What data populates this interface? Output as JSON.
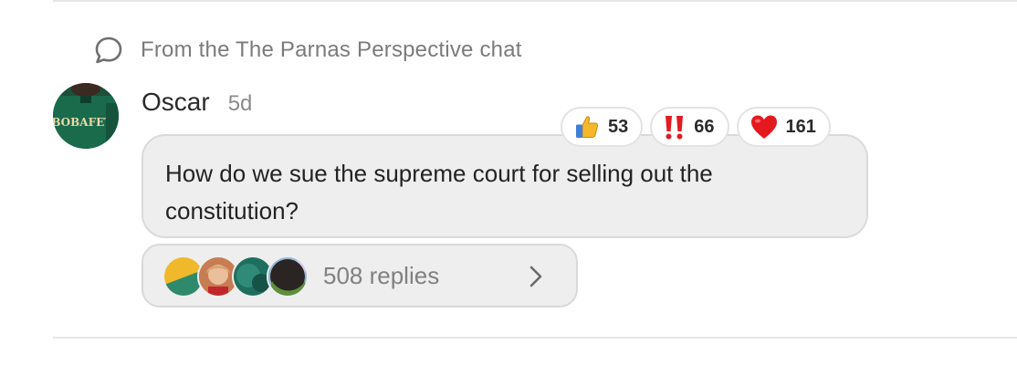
{
  "source": {
    "text": "From the The Parnas Perspective chat",
    "icon": "chat-bubble-icon"
  },
  "message": {
    "author": "Oscar",
    "time": "5d",
    "text": "How do we sue the supreme court for selling out the constitution?",
    "avatar_jersey_text": "BOBAFETT"
  },
  "reactions": [
    {
      "icon": "thumbs-up-icon",
      "count": "53"
    },
    {
      "icon": "double-exclamation-icon",
      "count": "66"
    },
    {
      "icon": "red-heart-icon",
      "count": "161"
    }
  ],
  "replies": {
    "label": "508 replies",
    "avatars": [
      "reply-avatar-1",
      "reply-avatar-2",
      "reply-avatar-3",
      "reply-avatar-4"
    ],
    "icon": "chevron-right-icon"
  },
  "colors": {
    "bubble_bg": "#eeeeee",
    "muted_text": "#7b7b7b",
    "heart": "#e3191f",
    "exclamation": "#e21b23",
    "thumb": "#f6b72a"
  }
}
